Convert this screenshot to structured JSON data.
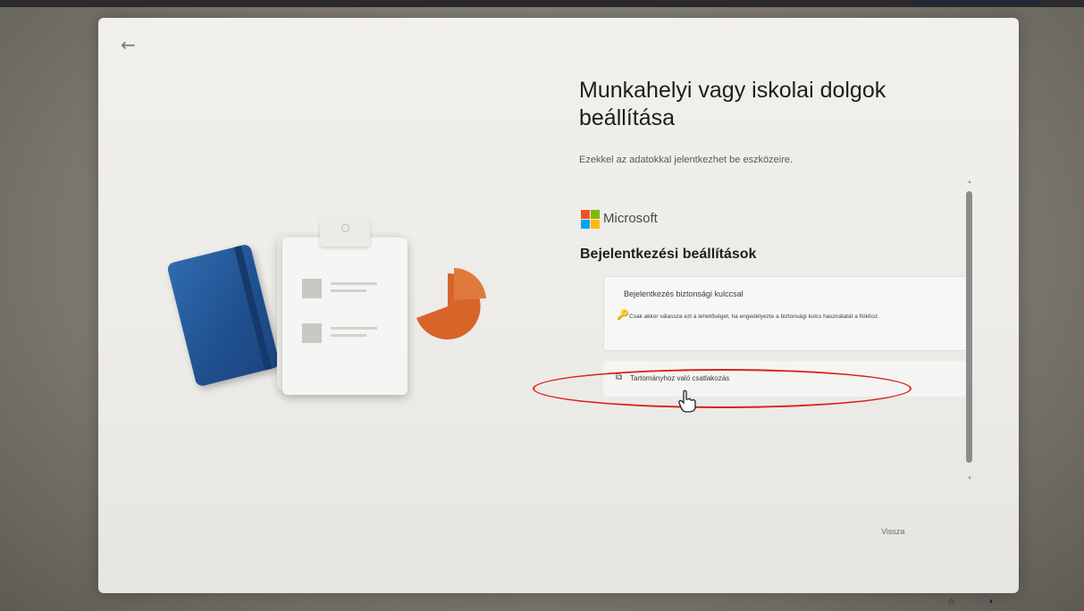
{
  "window": {
    "back_label": "←"
  },
  "header": {
    "title": "Munkahelyi vagy iskolai dolgok beállítása",
    "subtitle": "Ezekkel az adatokkal jelentkezhet be eszközeire."
  },
  "provider": {
    "name": "Microsoft"
  },
  "section": {
    "heading": "Bejelentkezési beállítások"
  },
  "options": {
    "security_key": {
      "title": "Bejelentkezés biztonsági kulccsal",
      "icon": "key-icon",
      "icon_glyph": "🔑",
      "description": "Csak akkor válassza ezt a lehetőséget, ha engedélyezte a biztonsági kulcs használatát a fiókhoz."
    },
    "domain_join": {
      "label": "Tartományhoz való csatlakozás",
      "icon": "domain-icon",
      "icon_glyph": "⧉"
    }
  },
  "footer": {
    "next_label": "Vissza"
  },
  "annotation": {
    "color": "#d9231c"
  },
  "colors": {
    "notebook": "#2f6cae",
    "pie": "#d7652a",
    "ms_red": "#f25022",
    "ms_green": "#7fba00",
    "ms_blue": "#00a4ef",
    "ms_yellow": "#ffb900"
  }
}
